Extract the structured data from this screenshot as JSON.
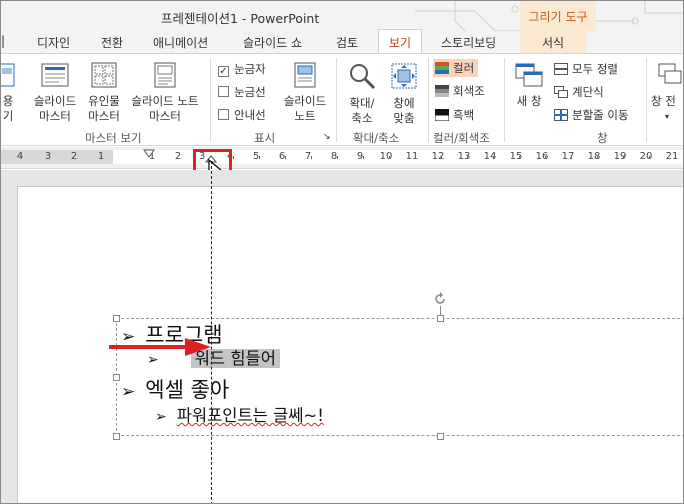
{
  "app": {
    "title": "프레젠테이션1 - PowerPoint",
    "context_group": "그리기 도구"
  },
  "tabs": [
    {
      "label": "디자인"
    },
    {
      "label": "전환"
    },
    {
      "label": "애니메이션"
    },
    {
      "label": "슬라이드 쇼"
    },
    {
      "label": "검토"
    },
    {
      "label": "보기",
      "active": true
    },
    {
      "label": "스토리보딩"
    },
    {
      "label": "서식",
      "contextual": true
    }
  ],
  "ribbon": {
    "partial_left_label1": "용",
    "partial_left_label2": "기",
    "master_views": {
      "slide_master": [
        "슬라이드",
        "마스터"
      ],
      "handout_master": [
        "유인물",
        "마스터"
      ],
      "notes_master": [
        "슬라이드 노트",
        "마스터"
      ],
      "group_label": "마스터 보기"
    },
    "show": {
      "ruler": {
        "label": "눈금자",
        "checked": true
      },
      "gridlines": {
        "label": "눈금선",
        "checked": false
      },
      "guides": {
        "label": "안내선",
        "checked": false
      },
      "notes": [
        "슬라이드",
        "노트"
      ],
      "group_label": "표시"
    },
    "zoom": {
      "zoom_btn": [
        "확대/",
        "축소"
      ],
      "fit_btn": [
        "창에",
        "맞춤"
      ],
      "group_label": "확대/축소"
    },
    "color": {
      "color": "컬러",
      "grayscale": "회색조",
      "bw": "흑백",
      "group_label": "컬러/회색조"
    },
    "window": {
      "new_window": "새 창",
      "arrange_all": "모두 정렬",
      "cascade": "계단식",
      "move_split": "분할줄 이동",
      "group_label": "창",
      "partial_right": "창 전"
    }
  },
  "ruler": {
    "numbers": [
      "4",
      "3",
      "2",
      "1",
      "1",
      "2",
      "3",
      "4",
      "5",
      "6",
      "7",
      "8",
      "9",
      "10",
      "11",
      "12",
      "13",
      "14",
      "15",
      "16",
      "17",
      "18",
      "19",
      "20",
      "21"
    ]
  },
  "slide": {
    "lines": [
      {
        "level": 1,
        "bullet": "➢",
        "text": "프로그램"
      },
      {
        "level": 2,
        "bullet": "➢",
        "text": "워드 힘들어",
        "selected": true
      },
      {
        "level": 1,
        "bullet": "➢",
        "text": "엑셀 좋아"
      },
      {
        "level": 2,
        "bullet": "➢",
        "text": "파워포인트는 글쎄~!",
        "spellcheck": true
      }
    ]
  },
  "colors": {
    "accent": "#c43e1c",
    "context_bg": "#fbe9d2",
    "context_text": "#c55a11",
    "annotation_red": "#e02020"
  }
}
